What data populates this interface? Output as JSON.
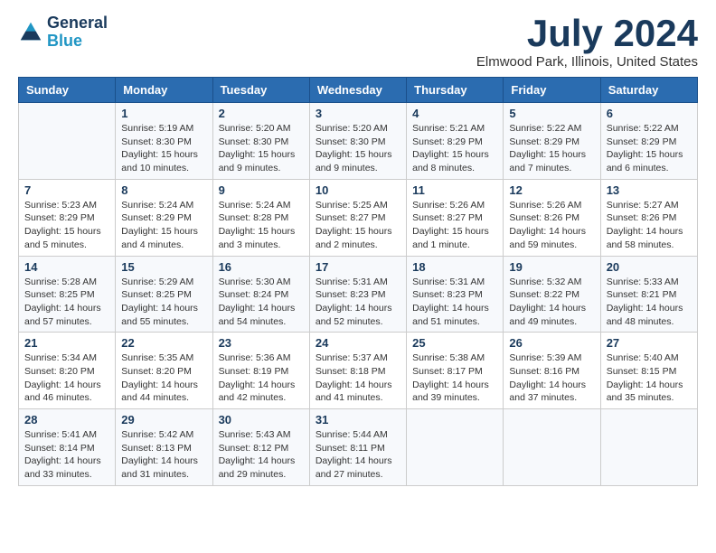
{
  "header": {
    "logo_line1": "General",
    "logo_line2": "Blue",
    "month_title": "July 2024",
    "location": "Elmwood Park, Illinois, United States"
  },
  "weekdays": [
    "Sunday",
    "Monday",
    "Tuesday",
    "Wednesday",
    "Thursday",
    "Friday",
    "Saturday"
  ],
  "weeks": [
    [
      {
        "day": "",
        "sunrise": "",
        "sunset": "",
        "daylight": ""
      },
      {
        "day": "1",
        "sunrise": "Sunrise: 5:19 AM",
        "sunset": "Sunset: 8:30 PM",
        "daylight": "Daylight: 15 hours and 10 minutes."
      },
      {
        "day": "2",
        "sunrise": "Sunrise: 5:20 AM",
        "sunset": "Sunset: 8:30 PM",
        "daylight": "Daylight: 15 hours and 9 minutes."
      },
      {
        "day": "3",
        "sunrise": "Sunrise: 5:20 AM",
        "sunset": "Sunset: 8:30 PM",
        "daylight": "Daylight: 15 hours and 9 minutes."
      },
      {
        "day": "4",
        "sunrise": "Sunrise: 5:21 AM",
        "sunset": "Sunset: 8:29 PM",
        "daylight": "Daylight: 15 hours and 8 minutes."
      },
      {
        "day": "5",
        "sunrise": "Sunrise: 5:22 AM",
        "sunset": "Sunset: 8:29 PM",
        "daylight": "Daylight: 15 hours and 7 minutes."
      },
      {
        "day": "6",
        "sunrise": "Sunrise: 5:22 AM",
        "sunset": "Sunset: 8:29 PM",
        "daylight": "Daylight: 15 hours and 6 minutes."
      }
    ],
    [
      {
        "day": "7",
        "sunrise": "Sunrise: 5:23 AM",
        "sunset": "Sunset: 8:29 PM",
        "daylight": "Daylight: 15 hours and 5 minutes."
      },
      {
        "day": "8",
        "sunrise": "Sunrise: 5:24 AM",
        "sunset": "Sunset: 8:29 PM",
        "daylight": "Daylight: 15 hours and 4 minutes."
      },
      {
        "day": "9",
        "sunrise": "Sunrise: 5:24 AM",
        "sunset": "Sunset: 8:28 PM",
        "daylight": "Daylight: 15 hours and 3 minutes."
      },
      {
        "day": "10",
        "sunrise": "Sunrise: 5:25 AM",
        "sunset": "Sunset: 8:27 PM",
        "daylight": "Daylight: 15 hours and 2 minutes."
      },
      {
        "day": "11",
        "sunrise": "Sunrise: 5:26 AM",
        "sunset": "Sunset: 8:27 PM",
        "daylight": "Daylight: 15 hours and 1 minute."
      },
      {
        "day": "12",
        "sunrise": "Sunrise: 5:26 AM",
        "sunset": "Sunset: 8:26 PM",
        "daylight": "Daylight: 14 hours and 59 minutes."
      },
      {
        "day": "13",
        "sunrise": "Sunrise: 5:27 AM",
        "sunset": "Sunset: 8:26 PM",
        "daylight": "Daylight: 14 hours and 58 minutes."
      }
    ],
    [
      {
        "day": "14",
        "sunrise": "Sunrise: 5:28 AM",
        "sunset": "Sunset: 8:25 PM",
        "daylight": "Daylight: 14 hours and 57 minutes."
      },
      {
        "day": "15",
        "sunrise": "Sunrise: 5:29 AM",
        "sunset": "Sunset: 8:25 PM",
        "daylight": "Daylight: 14 hours and 55 minutes."
      },
      {
        "day": "16",
        "sunrise": "Sunrise: 5:30 AM",
        "sunset": "Sunset: 8:24 PM",
        "daylight": "Daylight: 14 hours and 54 minutes."
      },
      {
        "day": "17",
        "sunrise": "Sunrise: 5:31 AM",
        "sunset": "Sunset: 8:23 PM",
        "daylight": "Daylight: 14 hours and 52 minutes."
      },
      {
        "day": "18",
        "sunrise": "Sunrise: 5:31 AM",
        "sunset": "Sunset: 8:23 PM",
        "daylight": "Daylight: 14 hours and 51 minutes."
      },
      {
        "day": "19",
        "sunrise": "Sunrise: 5:32 AM",
        "sunset": "Sunset: 8:22 PM",
        "daylight": "Daylight: 14 hours and 49 minutes."
      },
      {
        "day": "20",
        "sunrise": "Sunrise: 5:33 AM",
        "sunset": "Sunset: 8:21 PM",
        "daylight": "Daylight: 14 hours and 48 minutes."
      }
    ],
    [
      {
        "day": "21",
        "sunrise": "Sunrise: 5:34 AM",
        "sunset": "Sunset: 8:20 PM",
        "daylight": "Daylight: 14 hours and 46 minutes."
      },
      {
        "day": "22",
        "sunrise": "Sunrise: 5:35 AM",
        "sunset": "Sunset: 8:20 PM",
        "daylight": "Daylight: 14 hours and 44 minutes."
      },
      {
        "day": "23",
        "sunrise": "Sunrise: 5:36 AM",
        "sunset": "Sunset: 8:19 PM",
        "daylight": "Daylight: 14 hours and 42 minutes."
      },
      {
        "day": "24",
        "sunrise": "Sunrise: 5:37 AM",
        "sunset": "Sunset: 8:18 PM",
        "daylight": "Daylight: 14 hours and 41 minutes."
      },
      {
        "day": "25",
        "sunrise": "Sunrise: 5:38 AM",
        "sunset": "Sunset: 8:17 PM",
        "daylight": "Daylight: 14 hours and 39 minutes."
      },
      {
        "day": "26",
        "sunrise": "Sunrise: 5:39 AM",
        "sunset": "Sunset: 8:16 PM",
        "daylight": "Daylight: 14 hours and 37 minutes."
      },
      {
        "day": "27",
        "sunrise": "Sunrise: 5:40 AM",
        "sunset": "Sunset: 8:15 PM",
        "daylight": "Daylight: 14 hours and 35 minutes."
      }
    ],
    [
      {
        "day": "28",
        "sunrise": "Sunrise: 5:41 AM",
        "sunset": "Sunset: 8:14 PM",
        "daylight": "Daylight: 14 hours and 33 minutes."
      },
      {
        "day": "29",
        "sunrise": "Sunrise: 5:42 AM",
        "sunset": "Sunset: 8:13 PM",
        "daylight": "Daylight: 14 hours and 31 minutes."
      },
      {
        "day": "30",
        "sunrise": "Sunrise: 5:43 AM",
        "sunset": "Sunset: 8:12 PM",
        "daylight": "Daylight: 14 hours and 29 minutes."
      },
      {
        "day": "31",
        "sunrise": "Sunrise: 5:44 AM",
        "sunset": "Sunset: 8:11 PM",
        "daylight": "Daylight: 14 hours and 27 minutes."
      },
      {
        "day": "",
        "sunrise": "",
        "sunset": "",
        "daylight": ""
      },
      {
        "day": "",
        "sunrise": "",
        "sunset": "",
        "daylight": ""
      },
      {
        "day": "",
        "sunrise": "",
        "sunset": "",
        "daylight": ""
      }
    ]
  ]
}
